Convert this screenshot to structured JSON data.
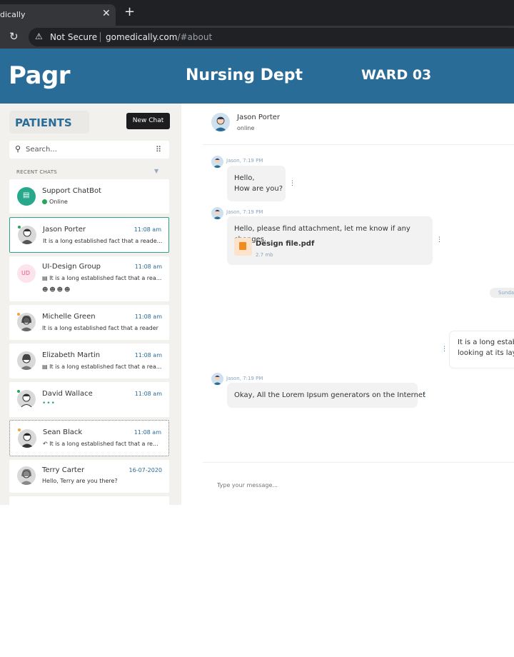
{
  "browser": {
    "tab_title": "dically",
    "close_glyph": "✕",
    "newtab_glyph": "+",
    "reload_glyph": "↻",
    "security_icon": "warning-icon",
    "security_label": "Not Secure",
    "url_host": "gomedically.com",
    "url_path": "/#about"
  },
  "header": {
    "logo": "Pagr",
    "dept": "Nursing Dept",
    "ward": "WARD 03"
  },
  "sidebar": {
    "title": "PATIENTS",
    "new_chat_label": "New Chat",
    "search_placeholder": "Search...",
    "recent_label": "RECENT CHATS",
    "chats": [
      {
        "name": "Support ChatBot",
        "status": "Online",
        "type": "bot"
      },
      {
        "name": "Jason Porter",
        "time": "11:08 am",
        "preview": "It is a long established fact that a reade..."
      },
      {
        "name": "UI-Design Group",
        "time": "11:08 am",
        "preview": "It is a long established fact that a rea...",
        "initials": "UD"
      },
      {
        "name": "Michelle Green",
        "time": "11:08 am",
        "preview": "It is a long established fact that a reader"
      },
      {
        "name": "Elizabeth Martin",
        "time": "11:08 am",
        "preview": "It is a long established fact that a rea..."
      },
      {
        "name": "David Wallace",
        "time": "11:08 am",
        "preview": "•••"
      },
      {
        "name": "Sean Black",
        "time": "11:08 am",
        "preview": "It is a long established fact that a re..."
      },
      {
        "name": "Terry Carter",
        "time": "16-07-2020",
        "preview": "Hello, Terry are you there?"
      }
    ]
  },
  "chat": {
    "contact_name": "Jason Porter",
    "contact_status": "online",
    "messages": [
      {
        "meta": "Jason, 7:19 PM",
        "line1": "Hello,",
        "line2": "How are you?"
      },
      {
        "meta": "Jason, 7:19 PM",
        "text": "Hello, please find attachment, let me know if any changes.",
        "file_name": "Design file.pdf",
        "file_size": "2.7 mb"
      },
      {
        "meta": "Jason, 7:19 PM",
        "text": "Okay, All the Lorem Ipsum generators on the Internet"
      }
    ],
    "date_divider": "Sunda",
    "outgoing": {
      "line1": "It is a long establ",
      "line2": "looking at its layo"
    },
    "composer_placeholder": "Type your message..."
  },
  "colors": {
    "brand": "#2a6c98",
    "online": "#26a65b",
    "accent": "#27a88a"
  }
}
